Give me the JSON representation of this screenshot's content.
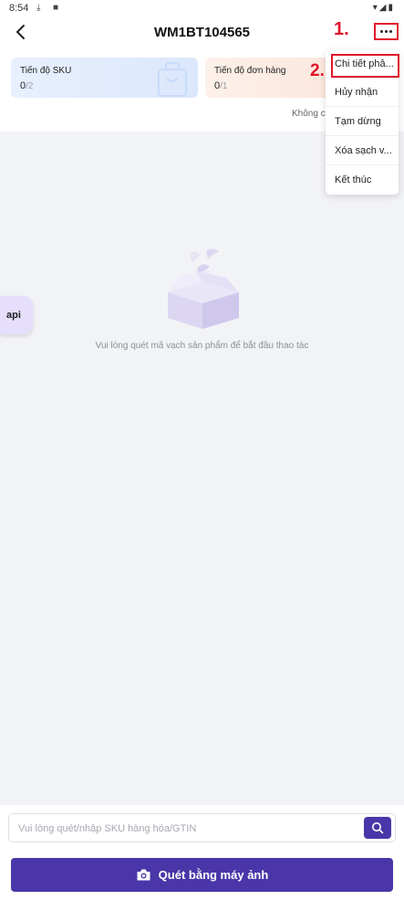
{
  "status_bar": {
    "time": "8:54",
    "icons_left": [
      "download-icon",
      "a-icon"
    ],
    "icons_right": [
      "wifi-icon",
      "signal-icon",
      "battery-icon"
    ]
  },
  "header": {
    "title": "WM1BT104565",
    "back_icon": "chevron-left-icon",
    "more_icon": "more-horizontal-icon"
  },
  "annotations": {
    "step1": "1.",
    "step2": "2.",
    "color": "#e0152c"
  },
  "progress_cards": {
    "sku": {
      "label": "Tiến độ SKU",
      "done": "0",
      "total": "/2"
    },
    "order": {
      "label": "Tiến độ đơn hàng",
      "done": "0",
      "total": "/1"
    }
  },
  "status_text": "Không c",
  "dropdown": {
    "items": [
      "Chi tiết phâ...",
      "Hủy nhận",
      "Tạm dừng",
      "Xóa sạch v...",
      "Kết thúc"
    ]
  },
  "empty_state": {
    "message": "Vui lòng quét mã vạch sản phẩm để bắt đầu thao tác",
    "icon": "empty-box-icon"
  },
  "floating": {
    "api_label": "api"
  },
  "search": {
    "placeholder": "Vui lòng quét/nhập SKU hàng hóa/GTIN",
    "value": "",
    "button_icon": "search-icon"
  },
  "scan_button": {
    "label": "Quét bằng máy ảnh",
    "icon": "camera-icon"
  },
  "colors": {
    "primary": "#4a36a8",
    "background": "#f2f3f6"
  }
}
